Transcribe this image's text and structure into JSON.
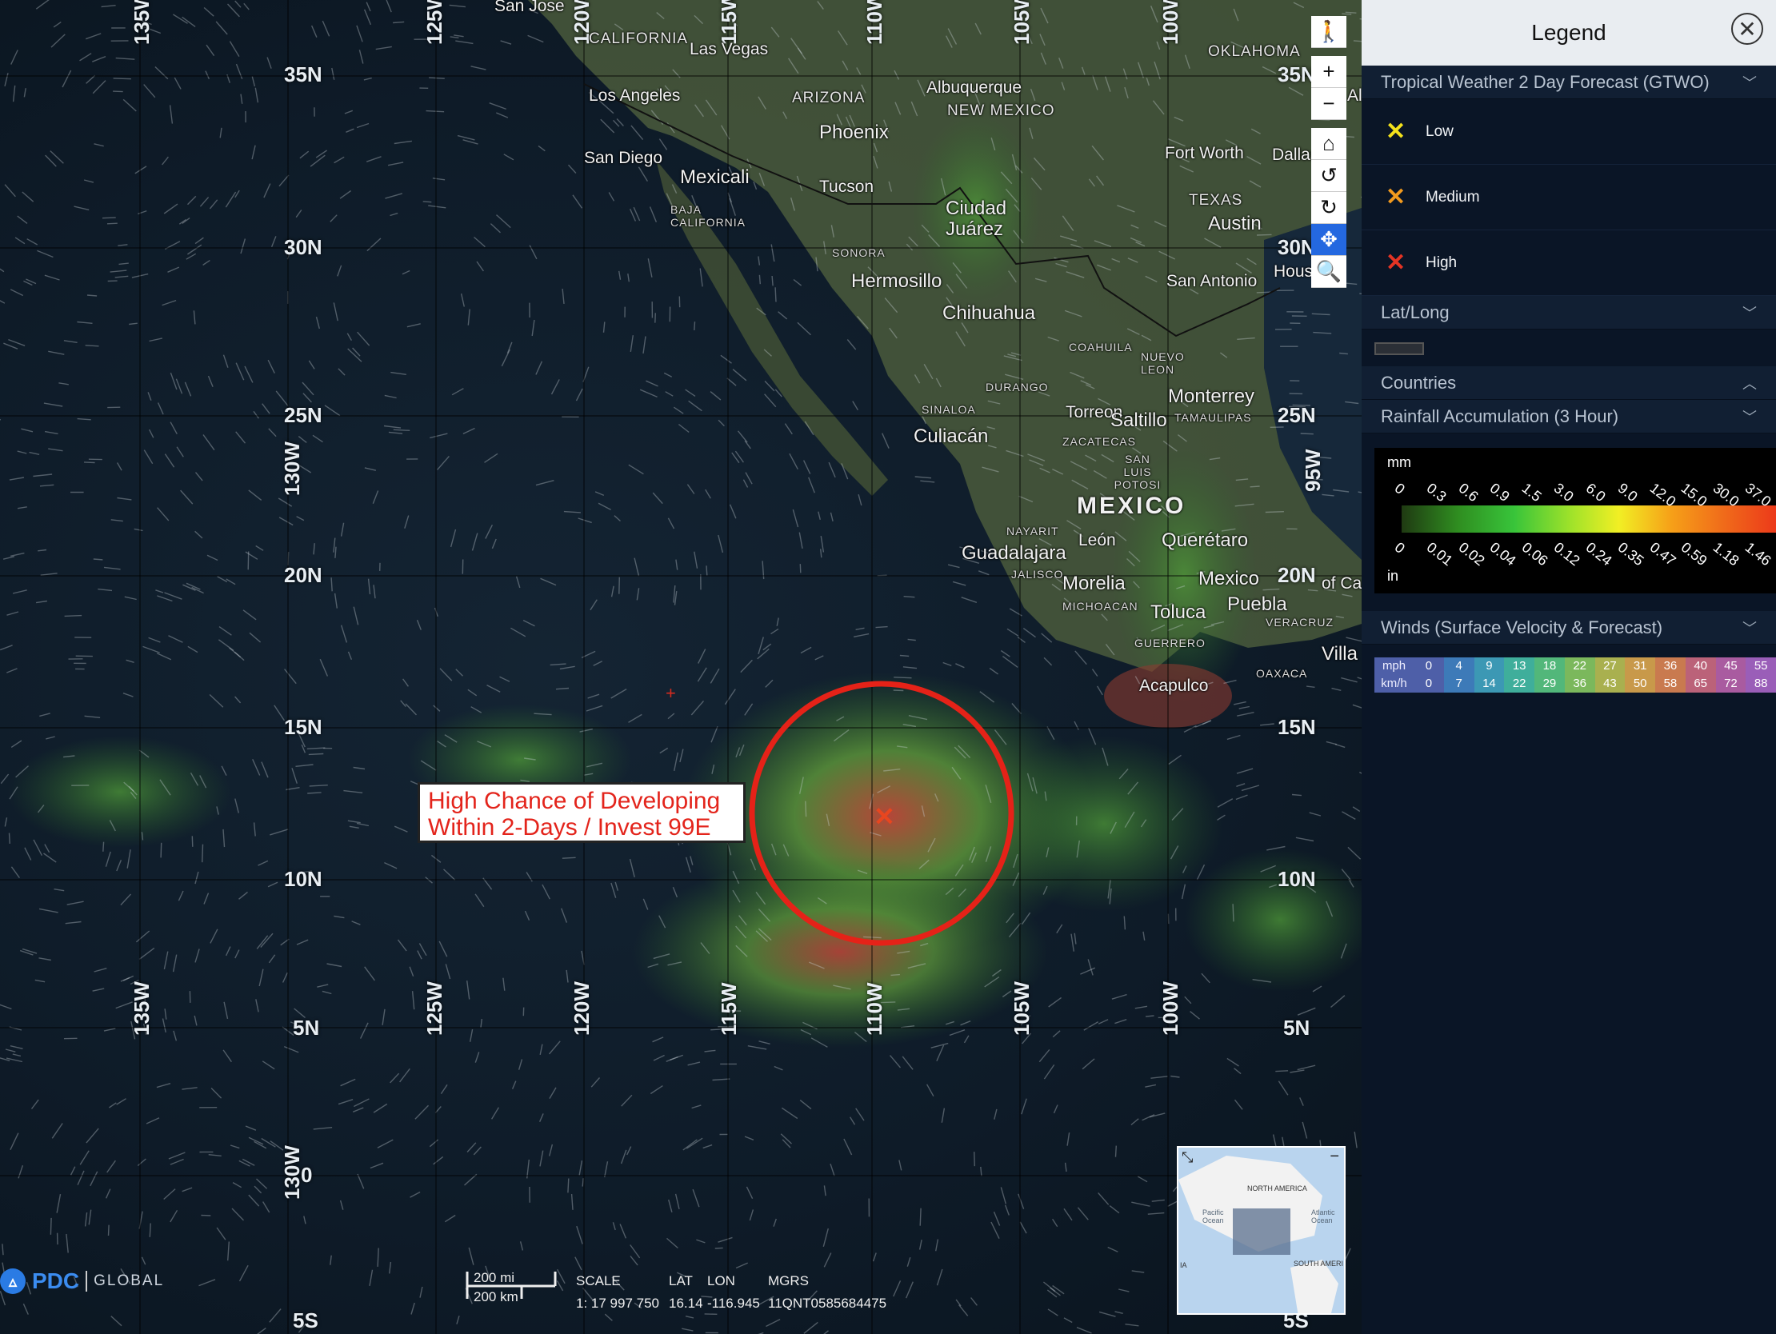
{
  "map": {
    "lat_labels_left": [
      "35N",
      "30N",
      "25N",
      "20N",
      "15N",
      "10N",
      "5N",
      "0",
      "5S"
    ],
    "lat_labels_right": [
      "35N",
      "30N",
      "25N",
      "20N",
      "15N",
      "10N",
      "5N",
      "5S"
    ],
    "lon_labels_top": [
      "135W",
      "125W",
      "120W",
      "115W",
      "110W",
      "105W",
      "100W"
    ],
    "lon_labels_bottom": [
      "135W",
      "125W",
      "120W",
      "115W",
      "110W",
      "105W",
      "100W"
    ],
    "lon_labels_left_side": [
      "130W",
      "130W"
    ],
    "lon_label_right_side": "95W",
    "cities": [
      "San Jose",
      "CALIFORNIA",
      "Las Vegas",
      "OKLAHOMA",
      "Los Angeles",
      "ARIZONA",
      "Albuquerque",
      "NEW MEXICO",
      "Phoenix",
      "San Diego",
      "Mexicali",
      "Tucson",
      "Fort Worth",
      "Dallas",
      "BAJA CALIFORNIA",
      "Ciudad Juárez",
      "TEXAS",
      "Austin",
      "SONORA",
      "Hermosillo",
      "San Antonio",
      "Hous",
      "Chihuahua",
      "COAHUILA",
      "NUEVO LEON",
      "DURANGO",
      "Monterrey",
      "SINALOA",
      "Torreon",
      "Saltillo",
      "TAMAULIPAS",
      "Culiacán",
      "ZACATECAS",
      "SAN LUIS POTOSI",
      "MEXICO",
      "NAYARIT",
      "León",
      "Querétaro",
      "Guadalajara",
      "JALISCO",
      "Morelia",
      "Mexico",
      "MICHOACAN",
      "Toluca",
      "Puebla",
      "VERACRUZ",
      "GUERRERO",
      "OAXACA",
      "Acapulco",
      "Villa",
      "of Ca",
      "Al"
    ],
    "callout_line1": "High Chance of Developing",
    "callout_line2": "Within 2-Days / Invest 99E",
    "minimap_labels": [
      "NORTH AMERICA",
      "Pacific Ocean",
      "Atlantic Ocean",
      "SOUTH AMERI",
      "IA"
    ]
  },
  "tools": {
    "zoom_in": "+",
    "zoom_out": "−"
  },
  "footer": {
    "brand": "PDC",
    "brand_sub": "GLOBAL",
    "scale_mi": "200 mi",
    "scale_km": "200 km",
    "scale_label": "SCALE",
    "scale_value": "1: 17 997 750",
    "lat_label": "LAT",
    "lat_value": "16.14",
    "lon_label": "LON",
    "lon_value": "-116.945",
    "mgrs_label": "MGRS",
    "mgrs_value": "11QNT0585684475"
  },
  "legend": {
    "title": "Legend",
    "sections": {
      "gtwo": "Tropical Weather 2 Day Forecast (GTWO)",
      "latlong": "Lat/Long",
      "countries": "Countries",
      "rainfall": "Rainfall Accumulation (3 Hour)",
      "winds": "Winds (Surface Velocity & Forecast)"
    },
    "gtwo_items": [
      {
        "label": "Low",
        "color": "#f4e21c"
      },
      {
        "label": "Medium",
        "color": "#f29a1e"
      },
      {
        "label": "High",
        "color": "#e53424"
      }
    ],
    "rain_unit_top": "mm",
    "rain_unit_bottom": "in",
    "rain_mm": [
      "0",
      "0.3",
      "0.6",
      "0.9",
      "1.5",
      "3.0",
      "6.0",
      "9.0",
      "12.0",
      "15.0",
      "30.0",
      "37.0"
    ],
    "rain_in": [
      "0",
      "0.01",
      "0.02",
      "0.04",
      "0.06",
      "0.12",
      "0.24",
      "0.35",
      "0.47",
      "0.59",
      "1.18",
      "1.46"
    ],
    "winds_mph_label": "mph",
    "winds_kmh_label": "km/h",
    "winds_mph": [
      "0",
      "4",
      "9",
      "13",
      "18",
      "22",
      "27",
      "31",
      "36",
      "40",
      "45",
      "55"
    ],
    "winds_kmh": [
      "0",
      "7",
      "14",
      "22",
      "29",
      "36",
      "43",
      "50",
      "58",
      "65",
      "72",
      "88"
    ],
    "winds_colors": [
      "#4e5fa8",
      "#3d7ab8",
      "#3c98b4",
      "#3fae9b",
      "#52b77a",
      "#7bb85c",
      "#a9b04f",
      "#c8994a",
      "#c97a4f",
      "#bb6279",
      "#a95ba0",
      "#9a5eb8"
    ]
  }
}
